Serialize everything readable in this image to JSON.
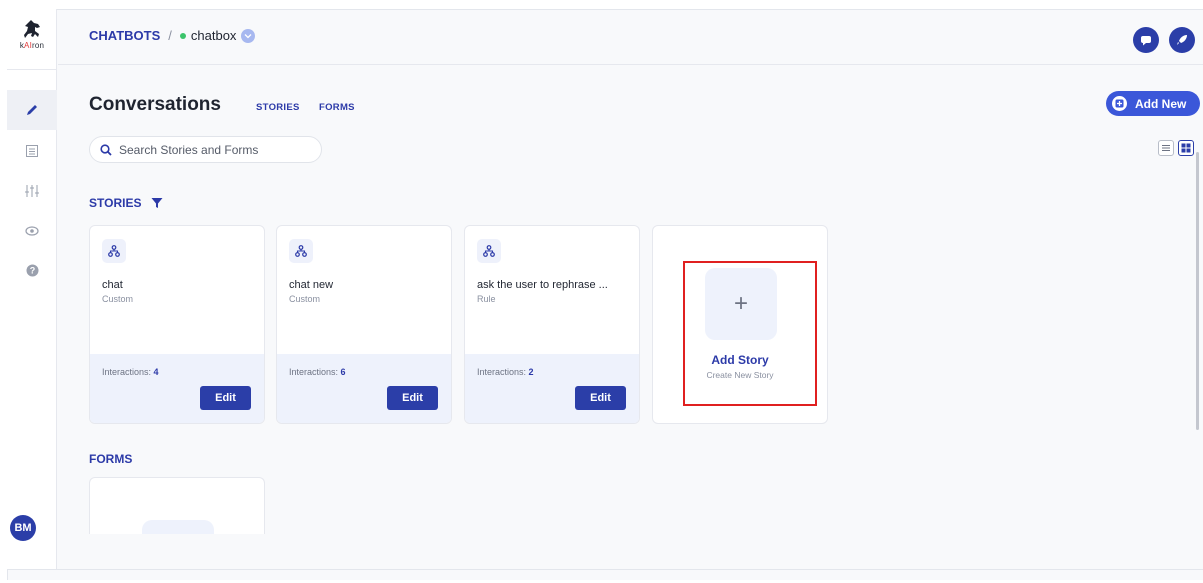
{
  "app": {
    "logo_text_pre": "k",
    "logo_text_accent": "AI",
    "logo_text_post": "ron"
  },
  "breadcrumb": {
    "root": "CHATBOTS",
    "separator": "/",
    "bot_name": "chatbox"
  },
  "page": {
    "title": "Conversations",
    "tabs": [
      "STORIES",
      "FORMS"
    ],
    "add_new_label": "Add New"
  },
  "search": {
    "placeholder": "Search Stories and Forms",
    "value": ""
  },
  "stories_section": {
    "label": "STORIES"
  },
  "forms_section": {
    "label": "FORMS"
  },
  "stories": [
    {
      "name": "chat",
      "type": "Custom",
      "interactions_label": "Interactions:",
      "interactions": "4",
      "edit_label": "Edit"
    },
    {
      "name": "chat new",
      "type": "Custom",
      "interactions_label": "Interactions:",
      "interactions": "6",
      "edit_label": "Edit"
    },
    {
      "name": "ask the user to rephrase ...",
      "type": "Rule",
      "interactions_label": "Interactions:",
      "interactions": "2",
      "edit_label": "Edit"
    }
  ],
  "add_story": {
    "plus": "+",
    "title": "Add Story",
    "subtitle": "Create New Story"
  },
  "user": {
    "initials": "BM"
  },
  "colors": {
    "primary": "#2b3ea8",
    "accent": "#3b57d9",
    "highlight": "#e02020",
    "online": "#3cc46b"
  }
}
